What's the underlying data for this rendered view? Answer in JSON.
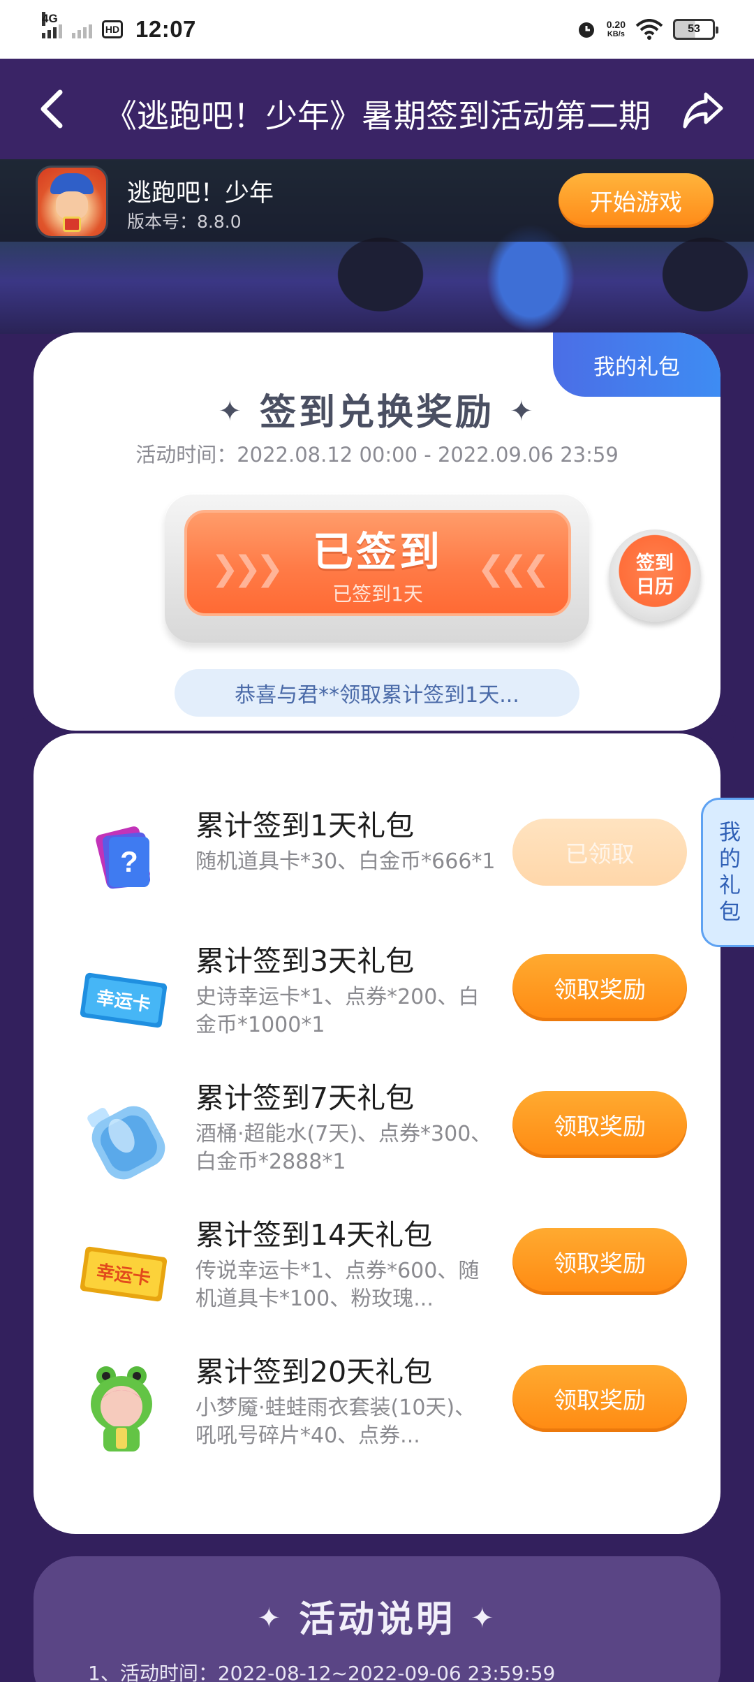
{
  "status_bar": {
    "network": "4G",
    "hd": "HD",
    "time": "12:07",
    "speed_value": "0.20",
    "speed_unit": "KB/s",
    "battery": "53"
  },
  "header": {
    "title": "《逃跑吧！少年》暑期签到活动第二期"
  },
  "banner": {
    "game_name": "逃跑吧！少年",
    "version": "版本号：8.8.0",
    "start_label": "开始游戏"
  },
  "checkin": {
    "my_gift_tab": "我的礼包",
    "title": "签到兑换奖励",
    "time": "活动时间：2022.08.12 00:00 - 2022.09.06 23:59",
    "button_main": "已签到",
    "button_sub": "已签到1天",
    "calendar_line1": "签到",
    "calendar_line2": "日历",
    "congrats": "恭喜与君**领取累计签到1天..."
  },
  "side_tab": [
    "我",
    "的",
    "礼",
    "包"
  ],
  "gifts": [
    {
      "title": "累计签到1天礼包",
      "desc": "随机道具卡*30、白金币*666*1",
      "button": "已领取",
      "icon": "mystery-card-icon"
    },
    {
      "title": "累计签到3天礼包",
      "desc": "史诗幸运卡*1、点券*200、白金币*1000*1",
      "button": "领取奖励",
      "icon": "blue-lucky-card-icon",
      "icon_text": "幸运卡"
    },
    {
      "title": "累计签到7天礼包",
      "desc": "酒桶·超能水(7天)、点券*300、白金币*2888*1",
      "button": "领取奖励",
      "icon": "water-bucket-icon"
    },
    {
      "title": "累计签到14天礼包",
      "desc": "传说幸运卡*1、点券*600、随机道具卡*100、粉玫瑰...",
      "button": "领取奖励",
      "icon": "gold-lucky-card-icon",
      "icon_text": "幸运卡"
    },
    {
      "title": "累计签到20天礼包",
      "desc": "小梦魇·蛙蛙雨衣套装(10天)、吼吼号碎片*40、点券...",
      "button": "领取奖励",
      "icon": "frog-costume-character-icon"
    }
  ],
  "rules": {
    "title": "活动说明",
    "line1": "1、活动时间：2022-08-12~2022-09-06 23:59:59"
  },
  "colors": {
    "background": "#33205d",
    "accent_orange": "#ff8a12",
    "accent_blue": "#3e8cf3"
  }
}
